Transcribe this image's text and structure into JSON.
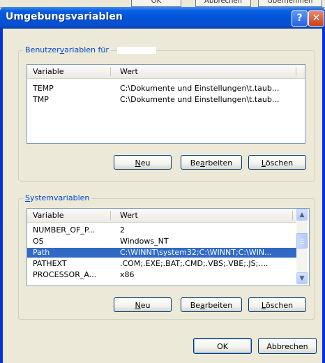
{
  "background_buttons": [
    "OK",
    "Abbrechen",
    "Übernehmen"
  ],
  "window": {
    "title": "Umgebungsvariablen",
    "help": "?",
    "close": "✕"
  },
  "user_vars": {
    "legend_pre": "Benutzer",
    "legend_u": "v",
    "legend_post": "ariablen für",
    "headers": {
      "variable": "Variable",
      "value": "Wert"
    },
    "rows": [
      {
        "name": "TEMP",
        "value": "C:\\Dokumente und Einstellungen\\t.taub..."
      },
      {
        "name": "TMP",
        "value": "C:\\Dokumente und Einstellungen\\t.taub..."
      }
    ],
    "buttons": {
      "new": {
        "u": "N",
        "rest": "eu"
      },
      "edit": {
        "pre": "Be",
        "u": "a",
        "post": "rbeiten"
      },
      "delete": {
        "u": "L",
        "rest": "öschen"
      }
    }
  },
  "system_vars": {
    "legend_u": "S",
    "legend_post": "ystemvariablen",
    "headers": {
      "variable": "Variable",
      "value": "Wert"
    },
    "rows": [
      {
        "name": "NUMBER_OF_P...",
        "value": "2",
        "selected": false
      },
      {
        "name": "OS",
        "value": "Windows_NT",
        "selected": false
      },
      {
        "name": "Path",
        "value": "C:\\WINNT\\system32;C:\\WINNT;C:\\WIN...",
        "selected": true
      },
      {
        "name": "PATHEXT",
        "value": ".COM;.EXE;.BAT;.CMD;.VBS;.VBE;.JS;....",
        "selected": false
      },
      {
        "name": "PROCESSOR_A...",
        "value": "x86",
        "selected": false
      }
    ],
    "buttons": {
      "new": {
        "u": "N",
        "rest": "eu"
      },
      "edit": {
        "pre": "Be",
        "u": "a",
        "post": "rbeiten"
      },
      "delete": {
        "u": "L",
        "rest": "öschen"
      }
    }
  },
  "footer": {
    "ok": "OK",
    "cancel": "Abbrechen"
  }
}
